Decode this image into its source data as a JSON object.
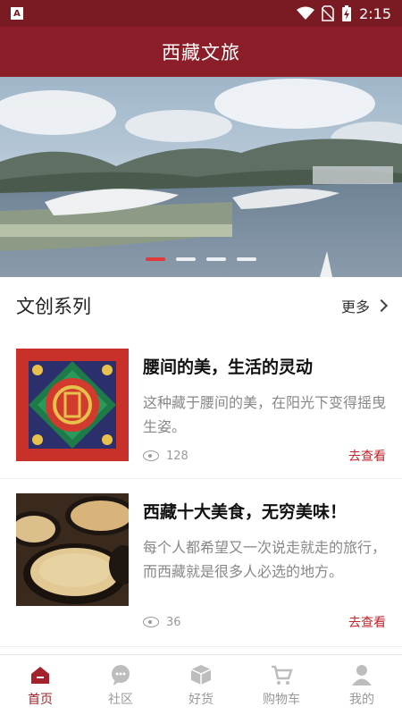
{
  "status": {
    "time": "2:15",
    "app_badge": "A"
  },
  "header": {
    "title": "西藏文旅"
  },
  "banner": {
    "slide_count": 4,
    "active_index": 0
  },
  "section": {
    "title": "文创系列",
    "more_label": "更多"
  },
  "articles": [
    {
      "title": "腰间的美，生活的灵动",
      "desc": "这种藏于腰间的美，在阳光下变得摇曳生姿。",
      "views": "128",
      "action": "去查看"
    },
    {
      "title": "西藏十大美食，无穷美味！",
      "desc": "每个人都希望又一次说走就走的旅行，而西藏就是很多人必选的地方。",
      "views": "36",
      "action": "去查看"
    }
  ],
  "tabs": [
    {
      "label": "首页",
      "icon": "home-icon",
      "active": true
    },
    {
      "label": "社区",
      "icon": "chat-icon",
      "active": false
    },
    {
      "label": "好货",
      "icon": "box-icon",
      "active": false
    },
    {
      "label": "购物车",
      "icon": "cart-icon",
      "active": false
    },
    {
      "label": "我的",
      "icon": "user-icon",
      "active": false
    }
  ],
  "colors": {
    "brand": "#8b1e28",
    "accent": "#c0232b",
    "inactive": "#999999"
  }
}
